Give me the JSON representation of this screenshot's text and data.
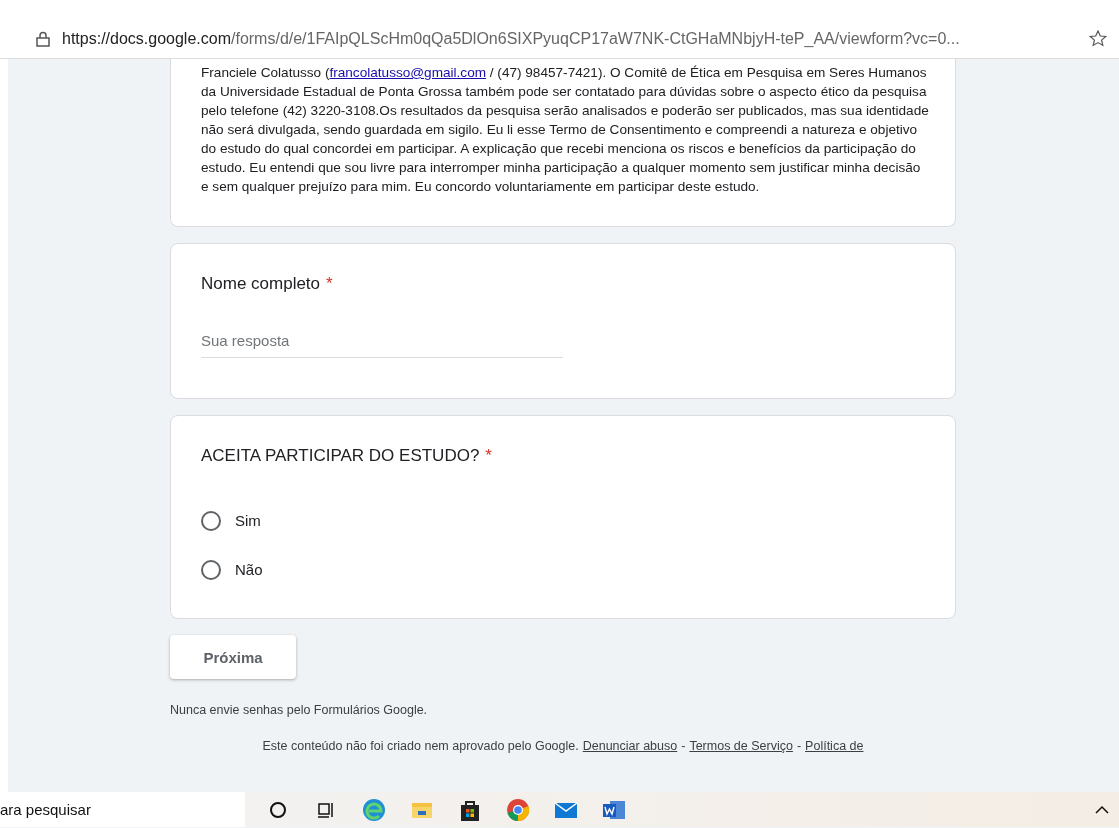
{
  "address_bar": {
    "url_host": "https://docs.google.com",
    "url_path": "/forms/d/e/1FAIpQLScHm0qQa5DlOn6SIXPyuqCP17aW7NK-CtGHaMNbjyH-teP_AA/viewform?vc=0..."
  },
  "consent": {
    "before_link": "Franciele Colatusso (",
    "link": "francolatusso@gmail.com",
    "after_link": " / (47) 98457-7421). O Comitê de Ética em Pesquisa em Seres Humanos da Universidade Estadual de Ponta Grossa também pode ser contatado para dúvidas sobre o aspecto ético da pesquisa pelo telefone (42) 3220-3108.Os resultados da pesquisa serão analisados e poderão ser publicados, mas sua identidade não será divulgada, sendo guardada em sigilo. Eu li esse Termo de Consentimento e compreendi a natureza e objetivo do estudo do qual concordei em participar. A explicação que recebi menciona os riscos e benefícios da participação do estudo. Eu entendi que sou livre para interromper minha participação a qualquer momento sem justificar minha decisão e sem qualquer prejuízo para mim. Eu concordo voluntariamente em participar deste estudo."
  },
  "questions": [
    {
      "kind": "text",
      "title": "Nome completo",
      "required_mark": "*",
      "placeholder": "Sua resposta"
    },
    {
      "kind": "radio",
      "title": "ACEITA PARTICIPAR DO ESTUDO?",
      "required_mark": "*",
      "options": [
        {
          "label": "Sim",
          "selected": false
        },
        {
          "label": "Não",
          "selected": false
        }
      ]
    }
  ],
  "next_button": "Próxima",
  "notice": "Nunca envie senhas pelo Formulários Google.",
  "footer": {
    "text": "Este conteúdo não foi criado nem aprovado pelo Google.",
    "links": [
      "Denunciar abuso",
      "Termos de Serviço",
      "Política de"
    ],
    "separator": "-"
  },
  "taskbar": {
    "search_text": "ara pesquisar"
  }
}
